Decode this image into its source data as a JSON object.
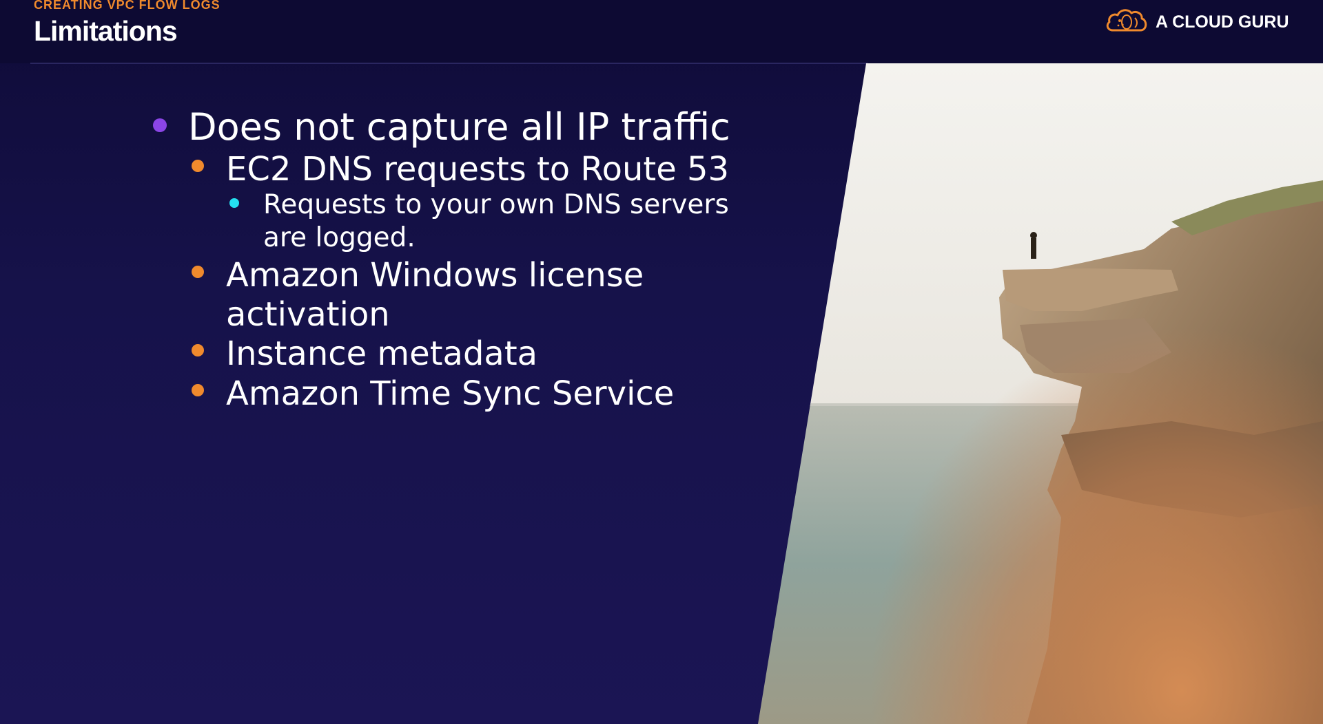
{
  "slide": {
    "section_label": "CREATING VPC FLOW LOGS",
    "title": "Limitations"
  },
  "brand": {
    "name": "A CLOUD GURU",
    "logo_icon": "cloud-logo-icon",
    "logo_color": "#f08a2d"
  },
  "bullets": {
    "level1": {
      "text": "Does not capture all IP traffic",
      "bullet_color": "#8b45e6"
    },
    "ec2_dns": {
      "text": "EC2 DNS requests to Route 53",
      "bullet_color": "#f08a2d"
    },
    "own_dns": {
      "line1": "Requests to your own DNS servers",
      "line2": "are logged.",
      "bullet_color": "#25e0f0"
    },
    "windows": {
      "line1": "Amazon Windows license",
      "line2": "activation",
      "bullet_color": "#f08a2d"
    },
    "metadata": {
      "text": "Instance metadata",
      "bullet_color": "#f08a2d"
    },
    "time_sync": {
      "text": "Amazon Time Sync Service",
      "bullet_color": "#f08a2d"
    }
  },
  "colors": {
    "background": "#16124a",
    "header": "#0d0a33",
    "accent_orange": "#f08a2d",
    "accent_purple": "#8b45e6",
    "accent_cyan": "#25e0f0"
  }
}
